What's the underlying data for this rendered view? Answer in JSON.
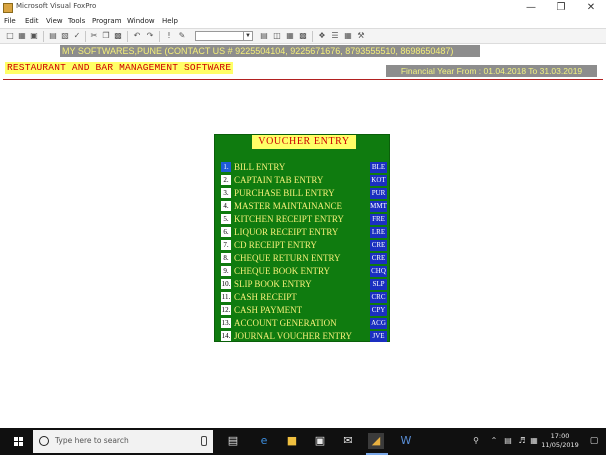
{
  "window": {
    "title": "Microsoft Visual FoxPro",
    "controls": [
      "minimize-icon",
      "maximize-icon",
      "close-icon"
    ]
  },
  "menu": {
    "items": [
      "File",
      "Edit",
      "View",
      "Tools",
      "Program",
      "Window",
      "Help"
    ]
  },
  "toolbar": {
    "icons": [
      "new-icon",
      "open-icon",
      "save-icon",
      "print-icon",
      "print-preview-icon",
      "spell-check-icon",
      "cut-icon",
      "copy-icon",
      "paste-icon",
      "undo-icon",
      "redo-icon",
      "run-icon",
      "modify-icon",
      "command-window-icon",
      "data-session-icon",
      "form-icon",
      "report-icon",
      "database-icon",
      "class-browser-icon",
      "component-gallery-icon",
      "coverage-icon",
      "tools-icon"
    ],
    "combo_value": ""
  },
  "header": {
    "company": "MY SOFTWARES,PUNE (CONTACT US # 9225504104, 9225671676, 8793555510, 8698650487)",
    "app_title": "RESTAURANT AND BAR MANAGEMENT SOFTWARE",
    "financial_year": "Financial Year From : 01.04.2018 To 31.03.2019"
  },
  "voucher_menu": {
    "title": "VOUCHER ENTRY",
    "items": [
      {
        "num": "1.",
        "label": "BILL ENTRY",
        "code": "BLE",
        "active": true
      },
      {
        "num": "2.",
        "label": "CAPTAIN TAB ENTRY",
        "code": "KOT"
      },
      {
        "num": "3.",
        "label": "PURCHASE BILL ENTRY",
        "code": "PUR"
      },
      {
        "num": "4.",
        "label": "MASTER MAINTAINANCE",
        "code": "MMT"
      },
      {
        "num": "5.",
        "label": "KITCHEN RECEIPT ENTRY",
        "code": "FRE"
      },
      {
        "num": "6.",
        "label": "LIQUOR RECEIPT ENTRY",
        "code": "LRE"
      },
      {
        "num": "7.",
        "label": "CD RECEIPT ENTRY",
        "code": "CRE"
      },
      {
        "num": "8.",
        "label": "CHEQUE RETURN ENTRY",
        "code": "CRE"
      },
      {
        "num": "9.",
        "label": "CHEQUE BOOK ENTRY",
        "code": "CHQ"
      },
      {
        "num": "10.",
        "label": "SLIP BOOK ENTRY",
        "code": "SLP"
      },
      {
        "num": "11.",
        "label": "CASH RECEIPT",
        "code": "CRC"
      },
      {
        "num": "12.",
        "label": "CASH PAYMENT",
        "code": "CPY"
      },
      {
        "num": "13.",
        "label": "ACCOUNT GENERATION",
        "code": "ACG"
      },
      {
        "num": "14.",
        "label": "JOURNAL VOUCHER ENTRY",
        "code": "JVE"
      }
    ]
  },
  "taskbar": {
    "search_placeholder": "Type here to search",
    "clock_time": "17:00",
    "clock_date": "11/05/2019",
    "colors": {
      "accent": "#7aa8e8",
      "background": "#101010"
    }
  },
  "colors": {
    "panel_green": "#0f7b0f",
    "label_yellow": "#f7f07a",
    "code_blue": "#1a2fc0",
    "title_red": "#cc0000",
    "banner_gray": "#8d8d8d"
  }
}
